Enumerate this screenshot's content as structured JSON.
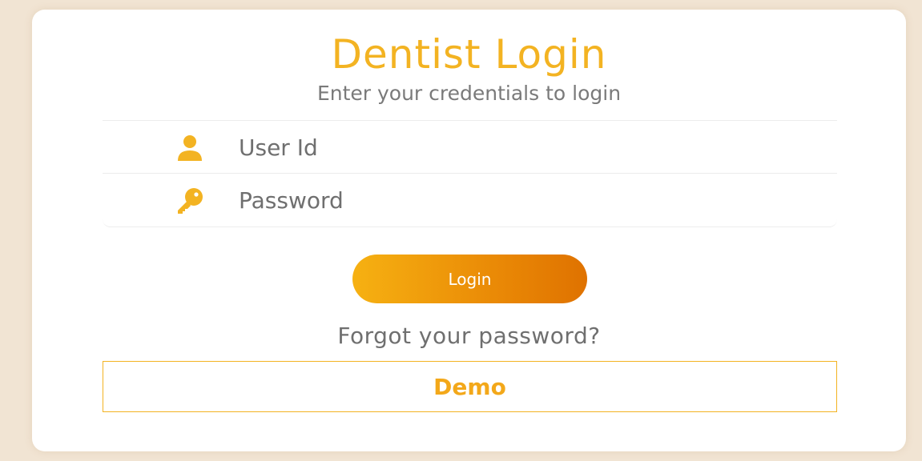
{
  "login": {
    "title": "Dentist Login",
    "subtitle": "Enter your credentials to login",
    "user_field": {
      "placeholder": "User Id",
      "value": "",
      "icon": "user-icon"
    },
    "password_field": {
      "placeholder": "Password",
      "value": "",
      "icon": "key-icon"
    },
    "login_button_label": "Login",
    "forgot_link_label": "Forgot your password?",
    "demo_button_label": "Demo"
  },
  "theme": {
    "accent": "#f3b322",
    "button_gradient_start": "#f6b112",
    "button_gradient_end": "#df7200",
    "background": "#f1e4d3",
    "card": "#ffffff",
    "muted_text": "#7a7a7a"
  }
}
